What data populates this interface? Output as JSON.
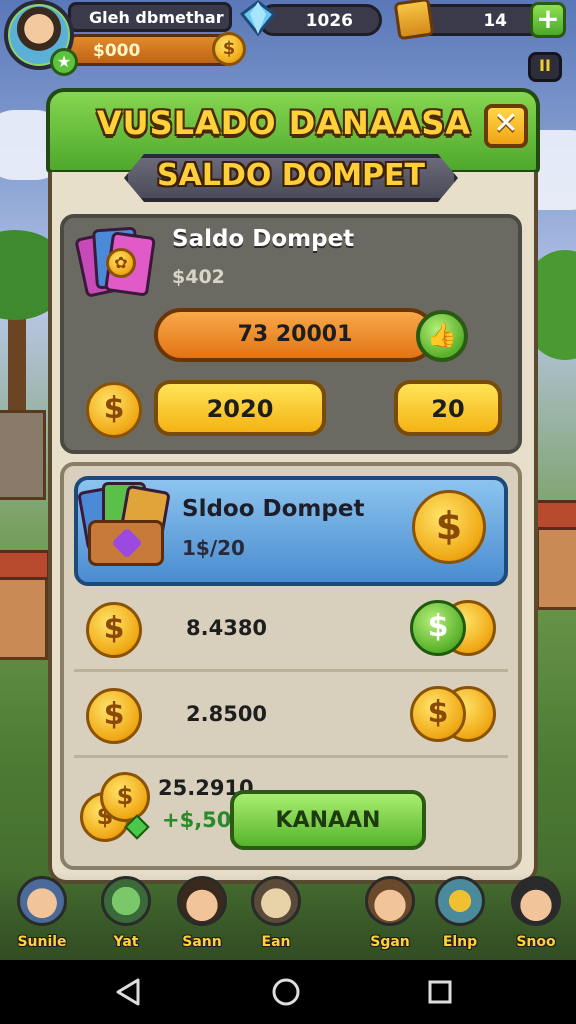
{
  "hud": {
    "player_name": "Gleh dbmethar",
    "gold": "$000",
    "gold_coin_symbol": "$",
    "gems": "1026",
    "crates": "14",
    "plus_label": "+",
    "pause_label": "II"
  },
  "panel": {
    "title": "VUSLADO DANAASA",
    "close_label": "✕",
    "ribbon": "SALDO DOMPET"
  },
  "top_section": {
    "title": "Saldo Dompet",
    "subtitle": "$402",
    "bar_value": "73 20001",
    "left_button": "2020",
    "right_button": "20",
    "coin_symbol": "$"
  },
  "wallet_card": {
    "title": "Sldoo Dompet",
    "subtitle": "1$/20",
    "coin_symbol": "$"
  },
  "rows": [
    {
      "value": "8.4380",
      "coin_symbol": "$"
    },
    {
      "value": "2.8500",
      "coin_symbol": "$"
    }
  ],
  "bottom": {
    "value": "25.2910",
    "subtitle": "+$,50",
    "claim_label": "KANAAN"
  },
  "characters": [
    {
      "label": "Sunile"
    },
    {
      "label": "Yat"
    },
    {
      "label": "Sann"
    },
    {
      "label": "Ean"
    },
    {
      "label": "Sgan"
    },
    {
      "label": "Elnp"
    },
    {
      "label": "Snoo"
    }
  ],
  "colors": {
    "panel_green": "#4ea82c",
    "title_gold": "#ffd23a",
    "blue_card": "#4a8cd0",
    "claim_green": "#58b42c"
  },
  "icons": [
    "gem-icon",
    "crate-icon",
    "plus-icon",
    "pause-icon",
    "close-icon",
    "cards-icon",
    "coin-icon",
    "thumbs-up-icon",
    "wallet-icon",
    "coin-pile-icon",
    "back-icon",
    "home-icon",
    "recents-icon"
  ]
}
